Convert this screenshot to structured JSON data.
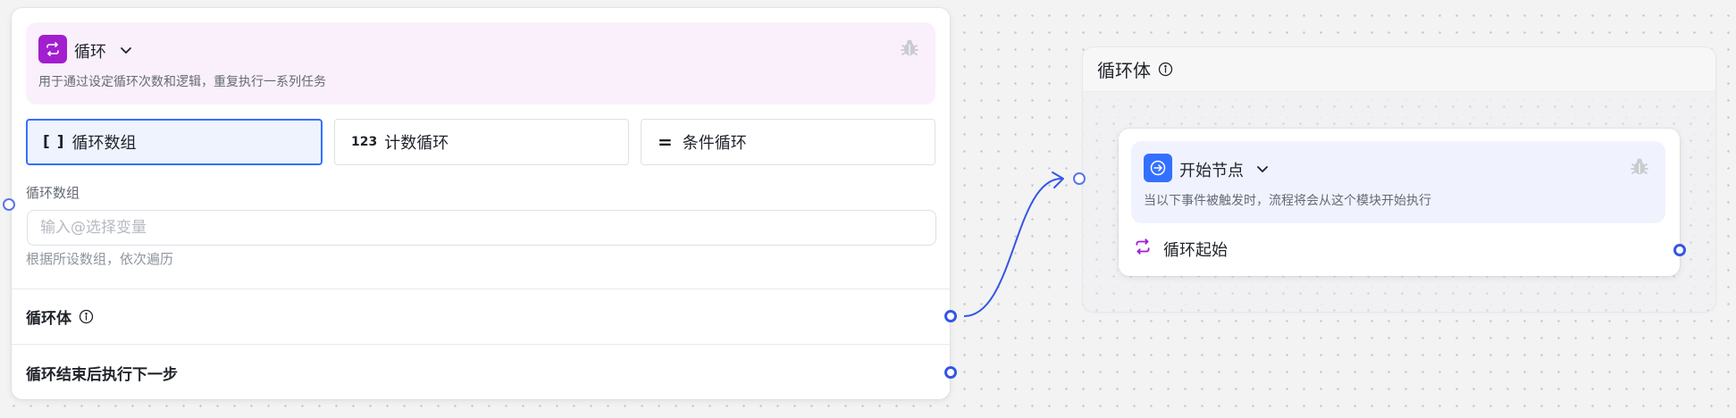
{
  "loop_node": {
    "title": "循环",
    "description": "用于通过设定循环次数和逻辑，重复执行一系列任务",
    "colors": {
      "accent": "#a21ecf",
      "header_bg": "#faf0fb"
    },
    "icons": {
      "node": "loop-icon",
      "dropdown": "chevron-down-icon",
      "debug": "bug-icon"
    },
    "modes": [
      {
        "glyph": "[ ]",
        "label": "循环数组",
        "active": true
      },
      {
        "glyph": "123",
        "label": "计数循环",
        "active": false
      },
      {
        "glyph": "=",
        "label": "条件循环",
        "active": false
      }
    ],
    "array_field": {
      "label": "循环数组",
      "placeholder": "输入@选择变量",
      "value": "",
      "hint": "根据所设数组，依次遍历"
    },
    "outputs": [
      {
        "label": "循环体",
        "has_info": true
      },
      {
        "label": "循环结束后执行下一步",
        "has_info": false
      }
    ]
  },
  "loop_body": {
    "title": "循环体",
    "start_node": {
      "title": "开始节点",
      "description": "当以下事件被触发时，流程将会从这个模块开始执行",
      "colors": {
        "accent": "#3370ff",
        "header_bg": "#f0f3fe"
      },
      "event": {
        "label": "循环起始",
        "icon": "loop-icon"
      }
    }
  },
  "colors": {
    "edge": "#3456e5",
    "selected_border": "#3370ff"
  }
}
